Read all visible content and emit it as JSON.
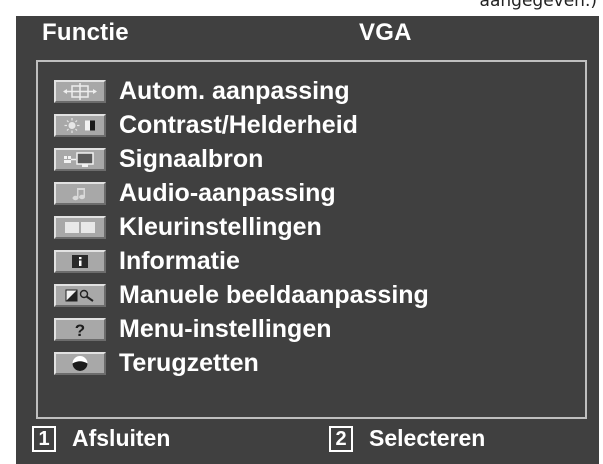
{
  "top_fragment": "aangegeven.)",
  "header": {
    "function_label": "Functie",
    "source_label": "VGA"
  },
  "menu": {
    "items": [
      {
        "label": "Autom. aanpassing",
        "icon": "auto-adjust-icon"
      },
      {
        "label": "Contrast/Helderheid",
        "icon": "contrast-brightness-icon"
      },
      {
        "label": "Signaalbron",
        "icon": "input-source-icon"
      },
      {
        "label": "Audio-aanpassing",
        "icon": "audio-note-icon"
      },
      {
        "label": "Kleurinstellingen",
        "icon": "color-settings-icon"
      },
      {
        "label": "Informatie",
        "icon": "information-icon"
      },
      {
        "label": "Manuele beeldaanpassing",
        "icon": "manual-image-adjust-icon"
      },
      {
        "label": "Menu-instellingen",
        "icon": "question-mark-icon"
      },
      {
        "label": "Terugzetten",
        "icon": "reset-icon"
      }
    ]
  },
  "footer": {
    "exit_key": "1",
    "exit_label": "Afsluiten",
    "select_key": "2",
    "select_label": "Selecteren"
  },
  "colors": {
    "osd_background": "#404040",
    "icon_tile": "#a8a8a8",
    "text": "#ffffff"
  }
}
